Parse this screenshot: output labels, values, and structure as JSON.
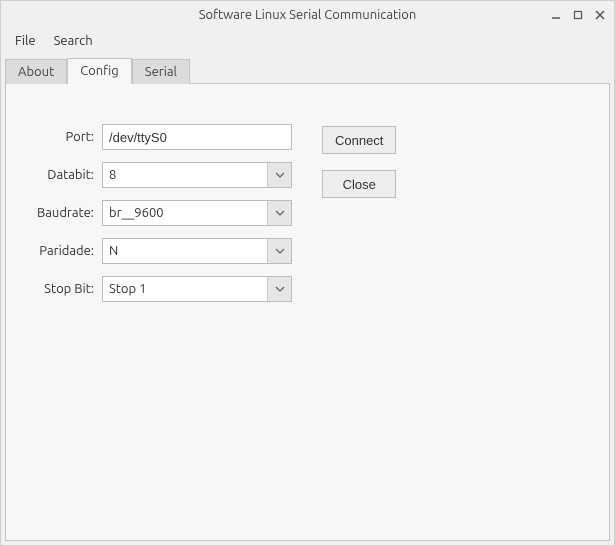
{
  "window": {
    "title": "Software Linux Serial Communication"
  },
  "menubar": {
    "file": "File",
    "search": "Search"
  },
  "tabs": {
    "about": "About",
    "config": "Config",
    "serial": "Serial"
  },
  "config": {
    "labels": {
      "port": "Port:",
      "databit": "Databit:",
      "baudrate": "Baudrate:",
      "paridade": "Paridade:",
      "stopbit": "Stop Bit:"
    },
    "values": {
      "port": "/dev/ttyS0",
      "databit": "8",
      "baudrate": "br__9600",
      "paridade": "N",
      "stopbit": "Stop 1"
    },
    "buttons": {
      "connect": "Connect",
      "close": "Close"
    }
  }
}
